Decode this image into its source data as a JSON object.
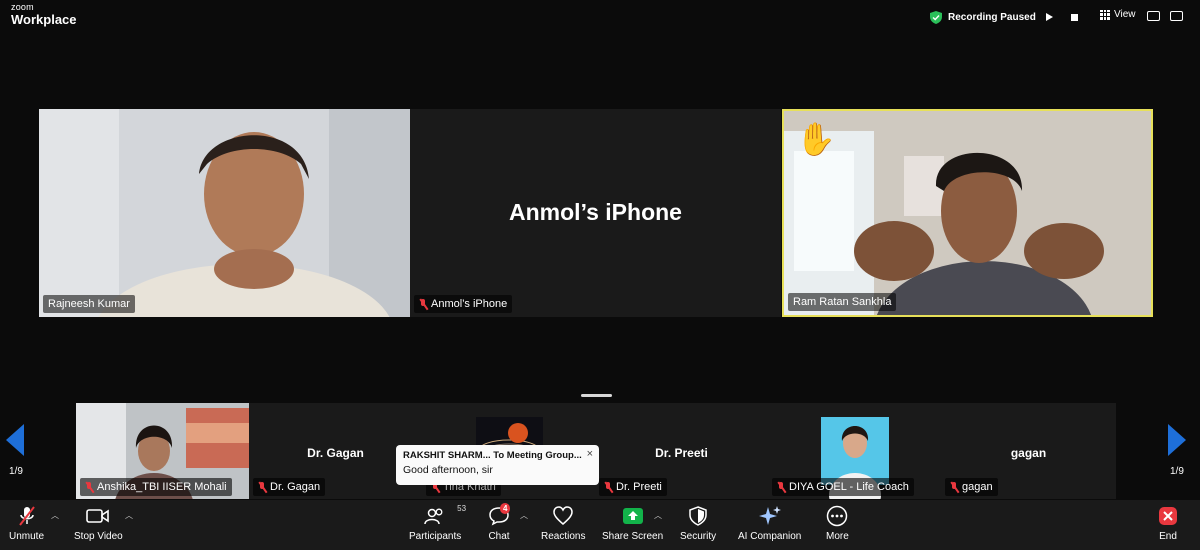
{
  "app": {
    "logo_top": "zoom",
    "logo_bottom": "Workplace"
  },
  "recording": {
    "status": "Recording Paused"
  },
  "view": {
    "label": "View"
  },
  "main_tiles": [
    {
      "name": "Rajneesh Kumar",
      "muted": false
    },
    {
      "name": "Anmol’s iPhone",
      "big_name": "Anmol’s iPhone",
      "muted": true
    },
    {
      "name": "Ram Ratan Sankhla",
      "muted": false,
      "hand_raised": true
    }
  ],
  "strip": {
    "page_left": "1/9",
    "page_right": "1/9",
    "cells": [
      {
        "name": "Anshika_TBI IISER Mohali",
        "muted": true
      },
      {
        "name": "Dr. Gagan",
        "center": "Dr. Gagan",
        "muted": true
      },
      {
        "name": "Tina Khatri",
        "muted": true
      },
      {
        "name": "Dr. Preeti",
        "center": "Dr. Preeti",
        "muted": true
      },
      {
        "name": "DIYA GOEL - Life Coach",
        "muted": true
      },
      {
        "name": "gagan",
        "center": "gagan",
        "muted": true
      }
    ]
  },
  "toast": {
    "title": "RAKSHIT SHARM... To Meeting Group...",
    "message": "Good afternoon, sir",
    "close": "×"
  },
  "toolbar": {
    "unmute": "Unmute",
    "stop_video": "Stop Video",
    "participants": "Participants",
    "participants_count": "53",
    "chat": "Chat",
    "chat_badge": "4",
    "reactions": "Reactions",
    "share_screen": "Share Screen",
    "security": "Security",
    "ai_companion": "AI Companion",
    "more": "More",
    "end": "End"
  },
  "colors": {
    "accent": "#1e6fd9",
    "share": "#12b34a",
    "end": "#e9383f",
    "highlight": "#e7e05a"
  }
}
